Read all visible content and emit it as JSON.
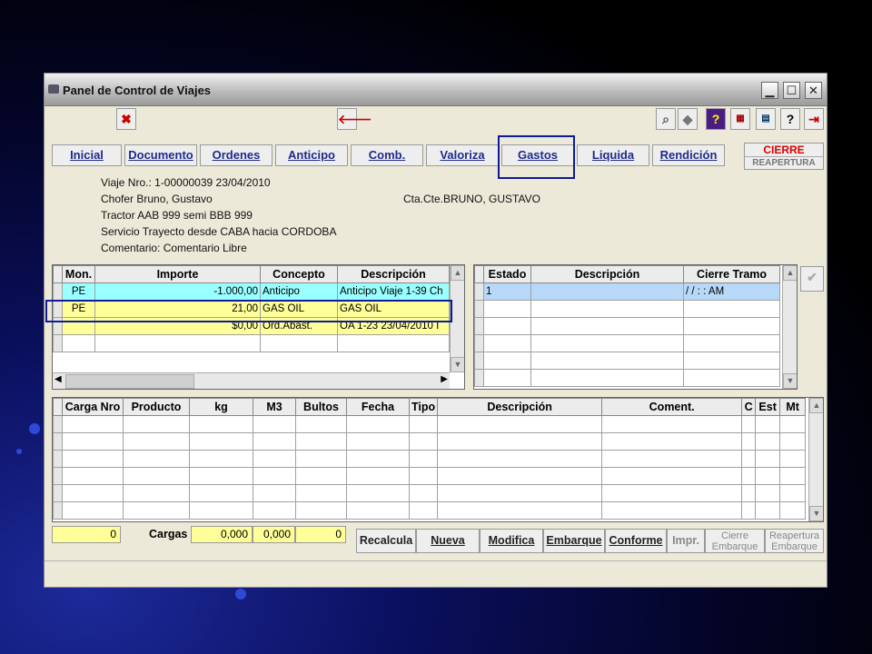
{
  "window": {
    "title": "Panel de Control de Viajes",
    "minimize": "▁",
    "maximize": "☐",
    "close": "✕"
  },
  "tabs": [
    "Inicial",
    "Documento",
    "Ordenes",
    "Anticipo",
    "Comb.",
    "Valoriza",
    "Gastos",
    "Liquida",
    "Rendición"
  ],
  "cierre": {
    "label": "CIERRE",
    "reapertura": "REAPERTURA"
  },
  "info": {
    "viaje": "Viaje Nro.: 1-00000039 23/04/2010",
    "chofer": "Chofer Bruno, Gustavo",
    "ctacte": "Cta.Cte.BRUNO, GUSTAVO",
    "tractor": "Tractor AAB 999    semi BBB 999",
    "servicio": "Servicio  Trayecto  desde CABA hacia CORDOBA",
    "comentario": "Comentario: Comentario Libre"
  },
  "gastos_table": {
    "headers": [
      "Mon.",
      "Importe",
      "Concepto",
      "Descripción"
    ],
    "rows": [
      [
        "PE",
        "-1.000,00",
        "Anticipo",
        "Anticipo Viaje 1-39 Ch"
      ],
      [
        "PE",
        "21,00",
        "GAS OIL",
        "GAS OIL"
      ],
      [
        "",
        "$0,00",
        "Ord.Abast.",
        "OA 1-23 23/04/2010 I"
      ],
      [
        "",
        "",
        "",
        ""
      ]
    ]
  },
  "estado_table": {
    "headers": [
      "Estado",
      "Descripción",
      "Cierre Tramo"
    ],
    "rows": [
      [
        "1",
        "",
        "/ /      : :   AM"
      ],
      [
        "",
        "",
        ""
      ],
      [
        "",
        "",
        ""
      ],
      [
        "",
        "",
        ""
      ],
      [
        "",
        "",
        ""
      ]
    ]
  },
  "cargas_table": {
    "headers": [
      "Carga Nro",
      "Producto",
      "kg",
      "M3",
      "Bultos",
      "Fecha",
      "Tipo",
      "Descripción",
      "Coment.",
      "C",
      "Est",
      "Mt"
    ]
  },
  "totals": {
    "count": "0",
    "label": "Cargas",
    "kg": "0,000",
    "m3": "0,000",
    "bultos": "0"
  },
  "buttons": {
    "recalcula": "Recalcula",
    "nueva": "Nueva",
    "modifica": "Modifica",
    "embarque": "Embarque",
    "conforme": "Conforme",
    "impr": "Impr.",
    "cierre_emb_1": "Cierre",
    "cierre_emb_2": "Embarque",
    "reap_emb_1": "Reapertura",
    "reap_emb_2": "Embarque"
  },
  "toolbar": {
    "back_arrow": "🡐",
    "help": "?",
    "question": "?"
  }
}
